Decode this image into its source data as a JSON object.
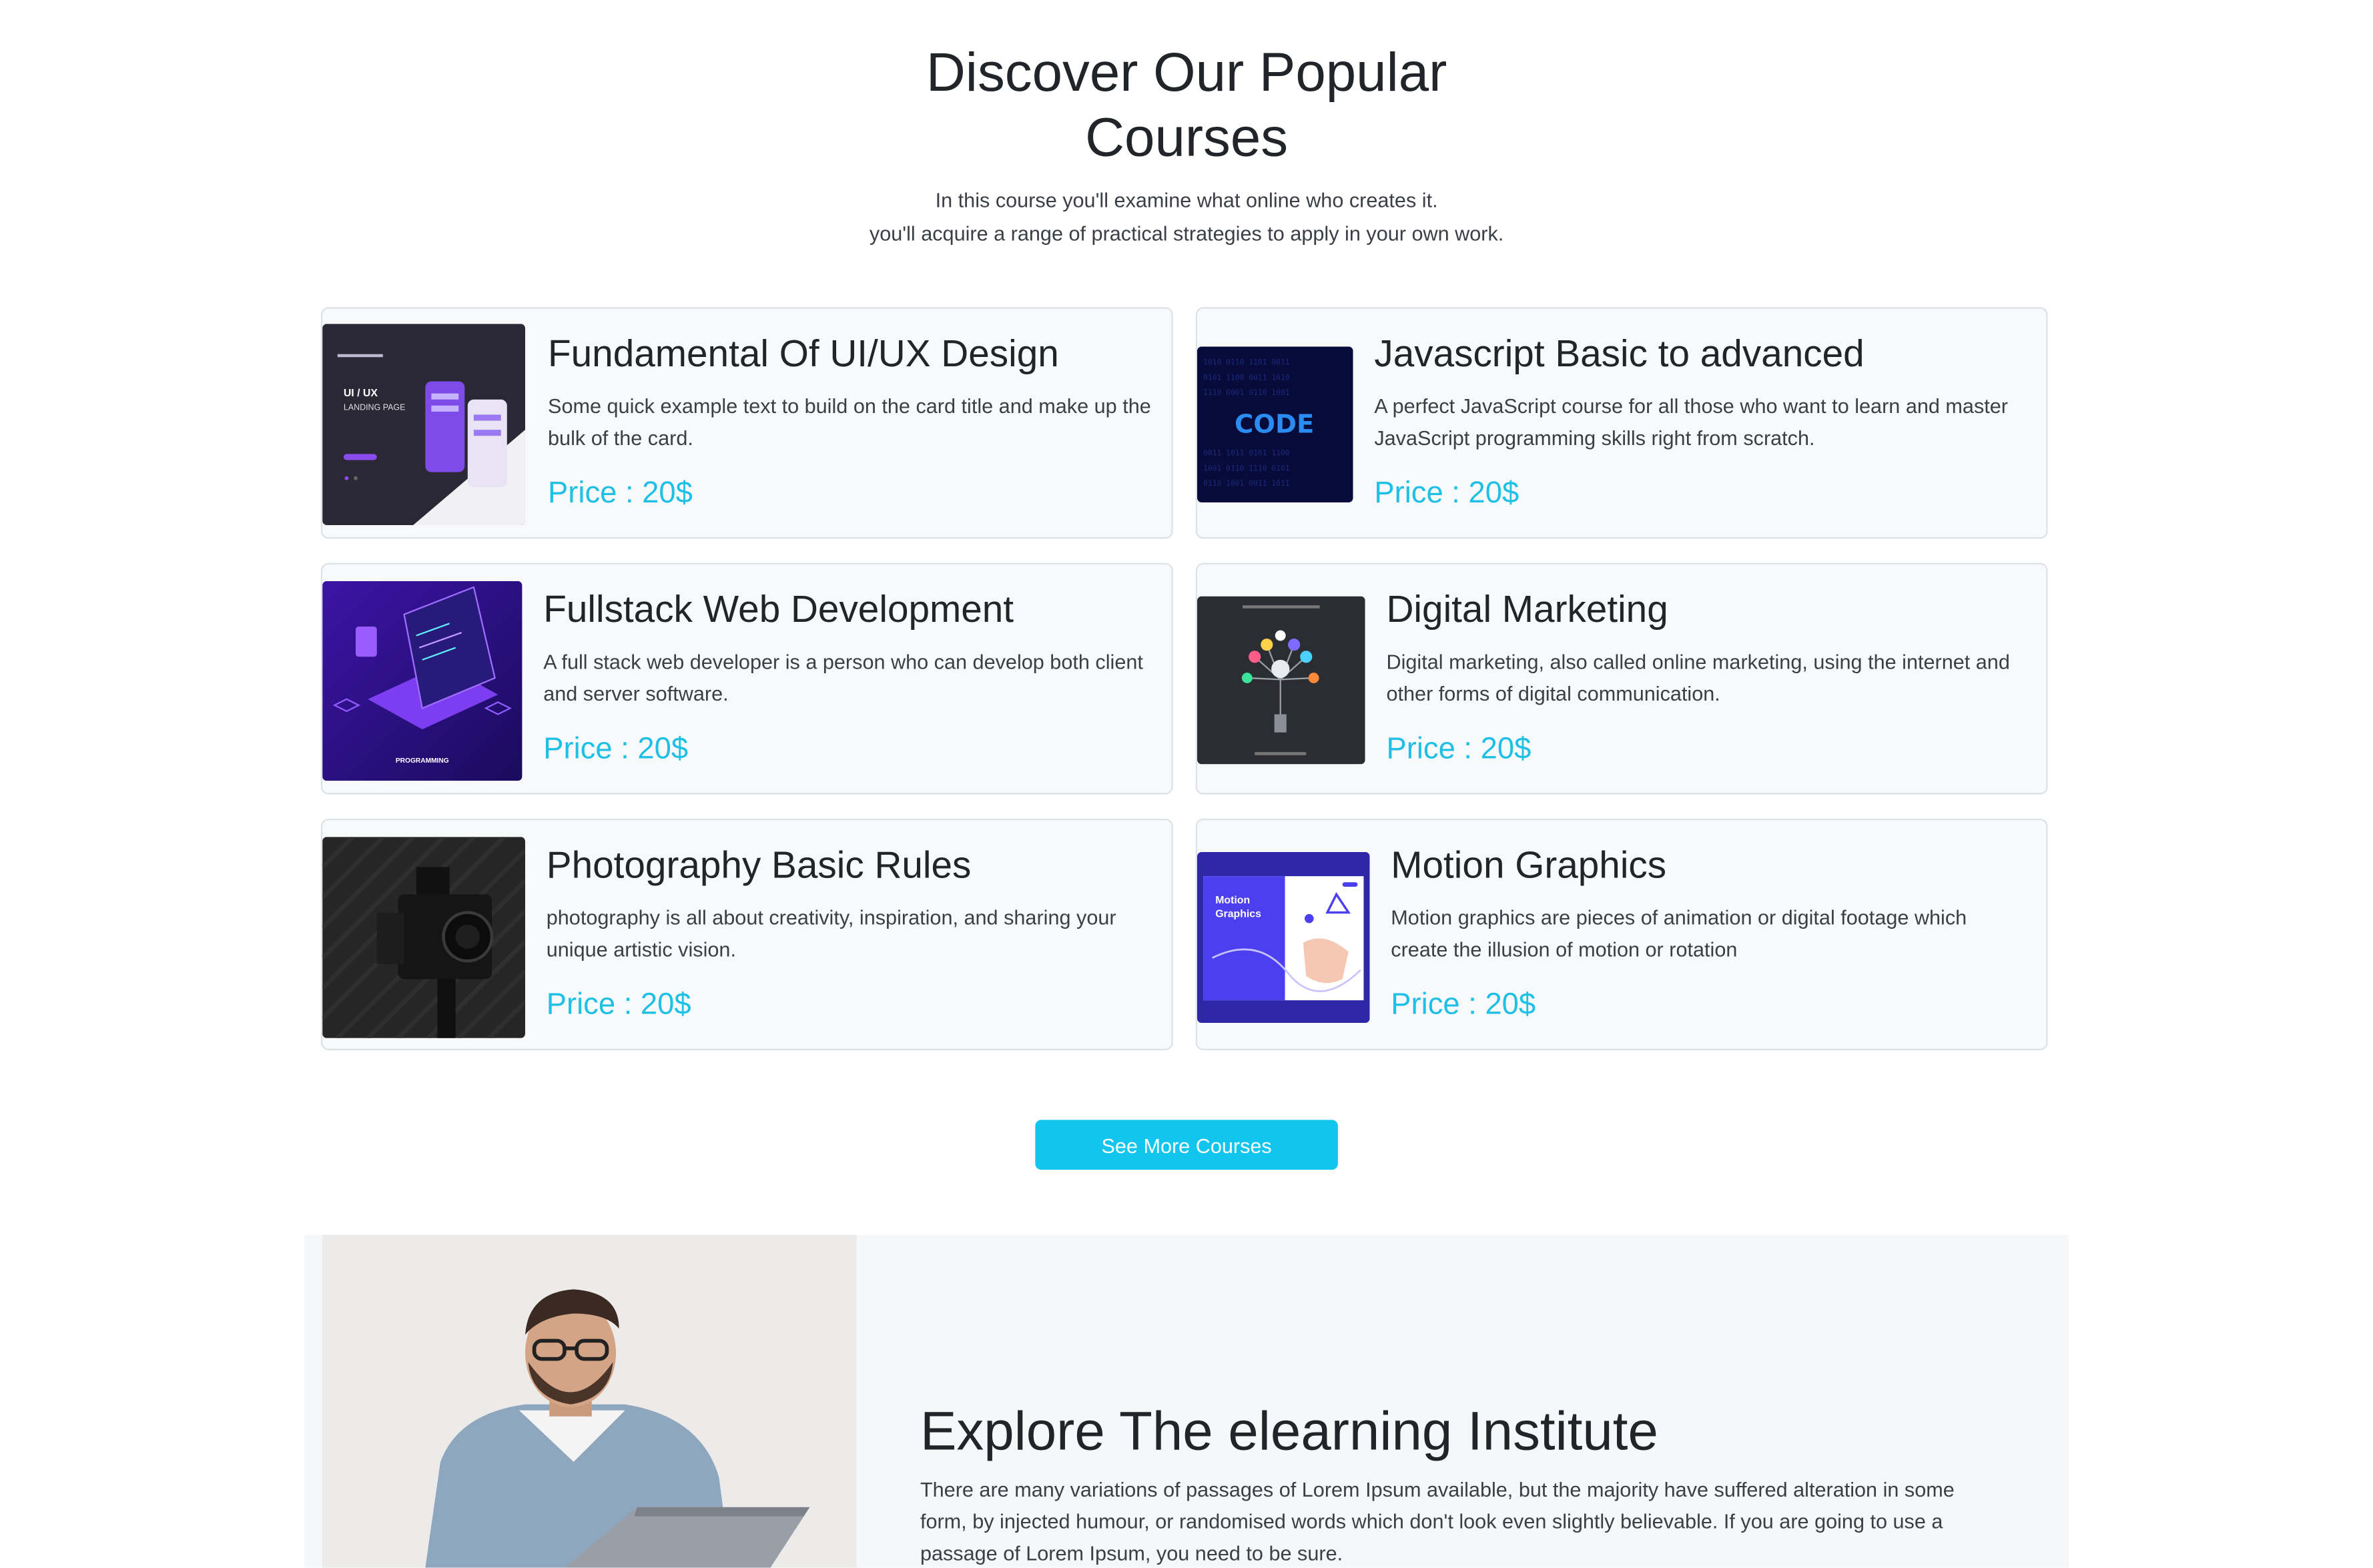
{
  "hero": {
    "title": "Discover Our Popular Courses",
    "subtitle_line1": "In this course you'll examine what online who creates it.",
    "subtitle_line2": "you'll acquire a range of practical strategies to apply in your own work."
  },
  "courses": [
    {
      "title": "Fundamental Of UI/UX Design",
      "description": "Some quick example text to build on the card title and make up the bulk of the card.",
      "price": "Price : 20$",
      "image_text": [
        "UI / UX",
        "LANDING PAGE"
      ]
    },
    {
      "title": "Javascript Basic to advanced",
      "description": "A perfect JavaScript course for all those who want to learn and master JavaScript programming skills right from scratch.",
      "price": "Price : 20$",
      "image_text": [
        "CODE"
      ]
    },
    {
      "title": "Fullstack Web Development",
      "description": "A full stack web developer is a person who can develop both client and server software.",
      "price": "Price : 20$",
      "image_text": [
        "PROGRAMMING"
      ]
    },
    {
      "title": "Digital Marketing",
      "description": "Digital marketing, also called online marketing, using the internet and other forms of digital communication.",
      "price": "Price : 20$",
      "image_text": []
    },
    {
      "title": "Photography Basic Rules",
      "description": "photography is all about creativity, inspiration, and sharing your unique artistic vision.",
      "price": "Price : 20$",
      "image_text": []
    },
    {
      "title": "Motion Graphics",
      "description": "Motion graphics are pieces of animation or digital footage which create the illusion of motion or rotation",
      "price": "Price : 20$",
      "image_text": [
        "Motion",
        "Graphics"
      ]
    }
  ],
  "see_more_label": "See More Courses",
  "explore": {
    "title": "Explore The elearning Institute",
    "paragraph": "There are many variations of passages of Lorem Ipsum available, but the majority have suffered alteration in some form, by injected humour, or randomised words which don't look even slightly believable. If you are going to use a passage of Lorem Ipsum, you need to be sure."
  },
  "colors": {
    "accent": "#11c5ee",
    "price": "#1ec0e6",
    "card_bg": "#f8f9fa",
    "text": "#212529"
  }
}
